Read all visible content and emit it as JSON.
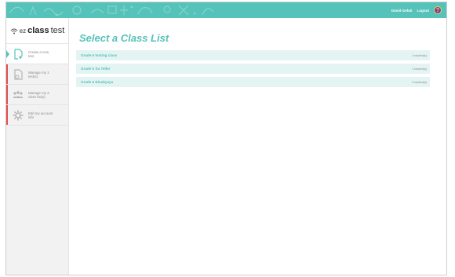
{
  "header": {
    "user_name": "David Gelati",
    "logout_label": "Logout",
    "help_label": "?",
    "colors": {
      "bar": "#55c3b9",
      "help_bg": "#7b3fa0",
      "help_fg": "#f2d34a"
    }
  },
  "brand": {
    "prefix": "ez",
    "bold": "class",
    "suffix": "test"
  },
  "sidebar": {
    "items": [
      {
        "label": "Create a new test",
        "icon": "new-test-icon",
        "accent": "#55c3b9",
        "active": true
      },
      {
        "label": "Manage my 1 test(s)",
        "icon": "manage-tests-icon",
        "accent": "#e24e4e",
        "active": false
      },
      {
        "label": "Manage my 3 class list(s)",
        "icon": "class-lists-icon",
        "accent": "#e24e4e",
        "active": false
      },
      {
        "label": "Edit my account info",
        "icon": "gear-icon",
        "accent": "#e24e4e",
        "active": false
      }
    ]
  },
  "main": {
    "title": "Select a Class List",
    "classes": [
      {
        "name": "Grade 6 testing class",
        "count": "1 student(s)"
      },
      {
        "name": "Grade 6 Su Teller",
        "count": "1 student(s)"
      },
      {
        "name": "Grade 6 Bisabyaya",
        "count": "2 student(s)"
      }
    ]
  }
}
